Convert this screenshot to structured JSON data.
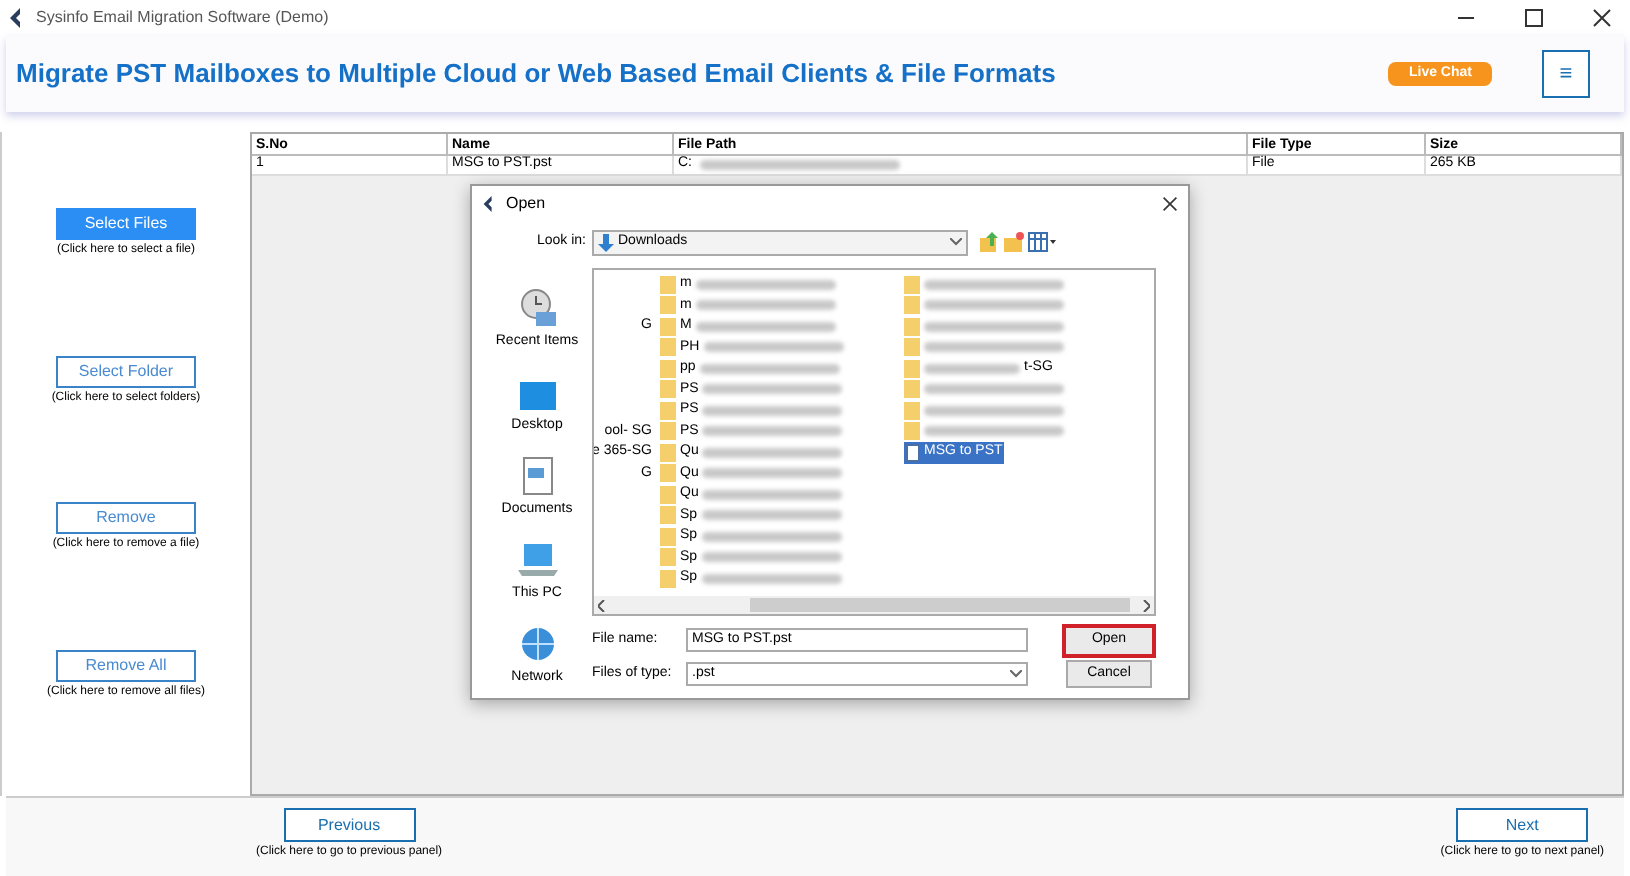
{
  "window": {
    "title": "Sysinfo Email Migration Software (Demo)"
  },
  "header": {
    "title": "Migrate PST Mailboxes to Multiple Cloud or Web Based Email Clients & File Formats",
    "live_chat": "Live Chat",
    "menu": "≡"
  },
  "actions": [
    {
      "label": "Select Files",
      "hint": "(Click here to select a file)",
      "selected": true
    },
    {
      "label": "Select Folder",
      "hint": "(Click here to select folders)",
      "selected": false
    },
    {
      "label": "Remove",
      "hint": "(Click here to remove a file)",
      "selected": false
    },
    {
      "label": "Remove All",
      "hint": "(Click here to remove all files)",
      "selected": false
    }
  ],
  "table": {
    "columns": [
      "S.No",
      "Name",
      "File Path",
      "File Type",
      "Size"
    ],
    "rows": [
      {
        "cells": [
          "1",
          "MSG to PST.pst",
          "C:",
          "File",
          "265 KB"
        ]
      }
    ]
  },
  "dialog": {
    "title": "Open",
    "look_in_label": "Look in:",
    "look_in": "Downloads",
    "places": [
      {
        "label": "Recent Items",
        "kind": "recent"
      },
      {
        "label": "Desktop",
        "kind": "desktop"
      },
      {
        "label": "Documents",
        "kind": "documents"
      },
      {
        "label": "This PC",
        "kind": "pc"
      },
      {
        "label": "Network",
        "kind": "network"
      }
    ],
    "file_columns": [
      [
        {
          "kind": "blank"
        },
        {
          "kind": "blank"
        },
        {
          "kind": "fragment",
          "text": "G"
        },
        {
          "kind": "blank"
        },
        {
          "kind": "blank"
        },
        {
          "kind": "blank"
        },
        {
          "kind": "blank"
        },
        {
          "kind": "fragment",
          "text": "ool- SG"
        },
        {
          "kind": "fragment",
          "text": "e 365-SG"
        },
        {
          "kind": "fragment",
          "text": "G"
        }
      ],
      [
        {
          "kind": "folder",
          "text": "m"
        },
        {
          "kind": "folder",
          "text": "m"
        },
        {
          "kind": "folder",
          "text": "M"
        },
        {
          "kind": "folder",
          "text": "PH"
        },
        {
          "kind": "folder",
          "text": "pp"
        },
        {
          "kind": "folder",
          "text": "PS"
        },
        {
          "kind": "folder",
          "text": "PS"
        },
        {
          "kind": "folder",
          "text": "PS"
        },
        {
          "kind": "folder",
          "text": "Qu"
        },
        {
          "kind": "folder",
          "text": "Qu"
        },
        {
          "kind": "folder",
          "text": "Qu"
        },
        {
          "kind": "folder",
          "text": "Sp"
        },
        {
          "kind": "folder",
          "text": "Sp"
        },
        {
          "kind": "folder",
          "text": "Sp"
        },
        {
          "kind": "folder",
          "text": "Sp"
        }
      ],
      [
        {
          "kind": "folder"
        },
        {
          "kind": "folder"
        },
        {
          "kind": "folder"
        },
        {
          "kind": "folder"
        },
        {
          "kind": "folder",
          "text_after": "t-SG"
        },
        {
          "kind": "folder"
        },
        {
          "kind": "folder"
        },
        {
          "kind": "folder"
        },
        {
          "kind": "file",
          "text": "MSG to PST",
          "selected": true
        }
      ]
    ],
    "file_name_label": "File name:",
    "file_name": "MSG to PST.pst",
    "type_label": "Files of type:",
    "type": ".pst",
    "open": "Open",
    "cancel": "Cancel"
  },
  "footer": [
    {
      "label": "Previous",
      "hint": "(Click here to go to previous panel)"
    },
    {
      "label": "Next",
      "hint": "(Click here to go to next panel)"
    }
  ]
}
